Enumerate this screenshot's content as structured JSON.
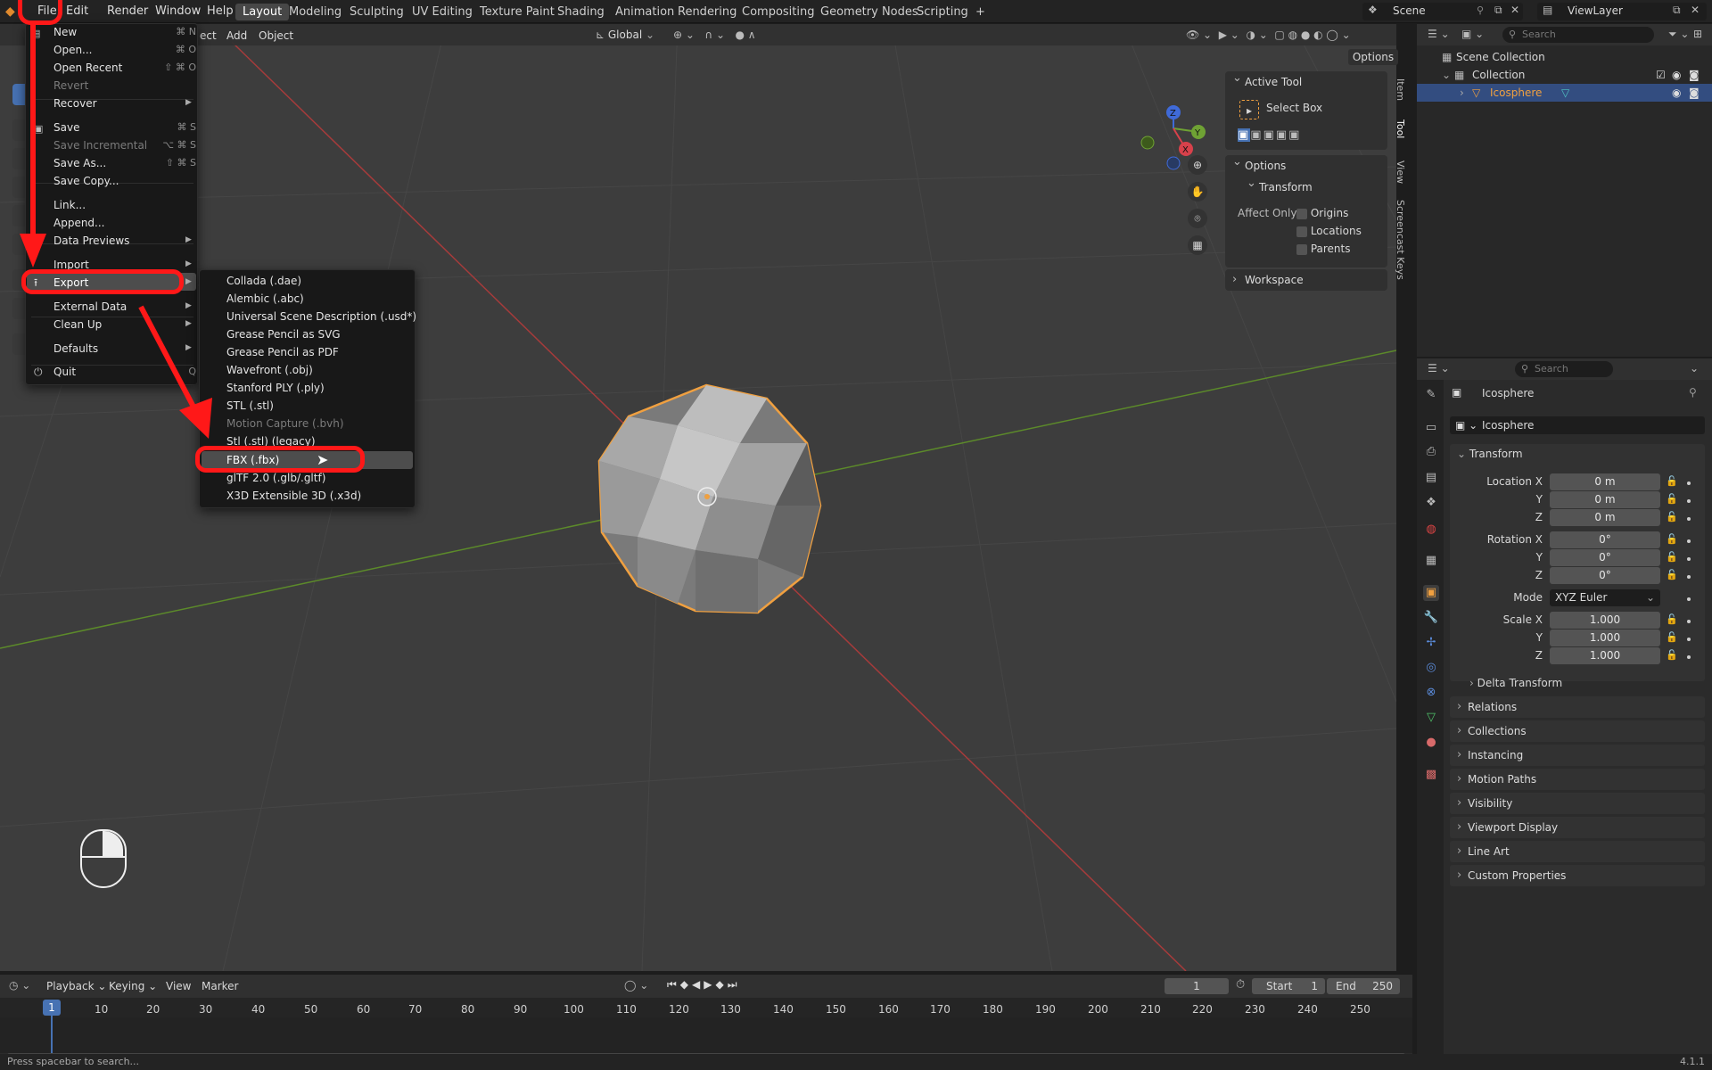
{
  "topbar": {
    "menus": [
      "File",
      "Edit",
      "Render",
      "Window",
      "Help"
    ],
    "workspaces": [
      "Layout",
      "Modeling",
      "Sculpting",
      "UV Editing",
      "Texture Paint",
      "Shading",
      "Animation",
      "Rendering",
      "Compositing",
      "Geometry Nodes",
      "Scripting"
    ],
    "active_workspace": "Layout",
    "add_tab": "+",
    "scene": "Scene",
    "view_layer": "ViewLayer"
  },
  "viewport_header": {
    "menus_visible": [
      "ect",
      "Add",
      "Object"
    ],
    "orientation": "Global",
    "options": "Options"
  },
  "file_menu": {
    "items": [
      {
        "label": "New",
        "shortcut": "⌘ N"
      },
      {
        "label": "Open...",
        "shortcut": "⌘ O"
      },
      {
        "label": "Open Recent",
        "shortcut": "⇧ ⌘ O"
      },
      {
        "label": "Revert",
        "shortcut": ""
      },
      {
        "label": "Recover",
        "shortcut": ""
      },
      {
        "label": "Save",
        "shortcut": "⌘ S"
      },
      {
        "label": "Save Incremental",
        "shortcut": "⌥ ⌘ S"
      },
      {
        "label": "Save As...",
        "shortcut": "⇧ ⌘ S"
      },
      {
        "label": "Save Copy...",
        "shortcut": ""
      },
      {
        "label": "Link...",
        "shortcut": ""
      },
      {
        "label": "Append...",
        "shortcut": ""
      },
      {
        "label": "Data Previews",
        "shortcut": ""
      },
      {
        "label": "Import",
        "shortcut": ""
      },
      {
        "label": "Export",
        "shortcut": ""
      },
      {
        "label": "External Data",
        "shortcut": ""
      },
      {
        "label": "Clean Up",
        "shortcut": ""
      },
      {
        "label": "Defaults",
        "shortcut": ""
      },
      {
        "label": "Quit",
        "shortcut": "Q"
      }
    ]
  },
  "export_menu": {
    "items": [
      "Collada (.dae)",
      "Alembic (.abc)",
      "Universal Scene Description (.usd*)",
      "Grease Pencil as SVG",
      "Grease Pencil as PDF",
      "Wavefront (.obj)",
      "Stanford PLY (.ply)",
      "STL (.stl)",
      "Motion Capture (.bvh)",
      "Stl (.stl) (legacy)",
      "FBX (.fbx)",
      "glTF 2.0 (.glb/.gltf)",
      "X3D Extensible 3D (.x3d)"
    ],
    "highlighted": "FBX (.fbx)"
  },
  "sidebar": {
    "tabs": [
      "Item",
      "Tool",
      "View",
      "Screencast Keys"
    ],
    "active_tool_header": "Active Tool",
    "active_tool": "Select Box",
    "options_header": "Options",
    "transform_header": "Transform",
    "affect_only": "Affect Only",
    "checks": [
      "Origins",
      "Locations",
      "Parents"
    ],
    "workspace_header": "Workspace"
  },
  "gizmo": {
    "x": "X",
    "y": "Y",
    "z": "Z"
  },
  "outliner": {
    "search_placeholder": "Search",
    "scene_collection": "Scene Collection",
    "collection": "Collection",
    "object": "Icosphere"
  },
  "properties": {
    "search_placeholder": "Search",
    "object_name": "Icosphere",
    "datablock": "Icosphere",
    "transform_header": "Transform",
    "location_label": "Location X",
    "y_label": "Y",
    "z_label": "Z",
    "rotation_label": "Rotation X",
    "mode_label": "Mode",
    "scale_label": "Scale X",
    "location": [
      "0 m",
      "0 m",
      "0 m"
    ],
    "rotation": [
      "0°",
      "0°",
      "0°"
    ],
    "mode": "XYZ Euler",
    "scale": [
      "1.000",
      "1.000",
      "1.000"
    ],
    "delta_transform": "Delta Transform",
    "sections": [
      "Relations",
      "Collections",
      "Instancing",
      "Motion Paths",
      "Visibility",
      "Viewport Display",
      "Line Art",
      "Custom Properties"
    ]
  },
  "timeline": {
    "menus": [
      "Playback",
      "Keying",
      "View",
      "Marker"
    ],
    "current_frame": "1",
    "start_label": "Start",
    "start": "1",
    "end_label": "End",
    "end": "250",
    "ticks": [
      "1",
      "10",
      "20",
      "30",
      "40",
      "50",
      "60",
      "70",
      "80",
      "90",
      "100",
      "110",
      "120",
      "130",
      "140",
      "150",
      "160",
      "170",
      "180",
      "190",
      "200",
      "210",
      "220",
      "230",
      "240",
      "250"
    ]
  },
  "status": {
    "hint": "Press spacebar to search...",
    "version": "4.1.1"
  },
  "colors": {
    "accent_red": "#ff1818",
    "selection_orange": "#f0a040",
    "active_blue": "#4772b3"
  }
}
